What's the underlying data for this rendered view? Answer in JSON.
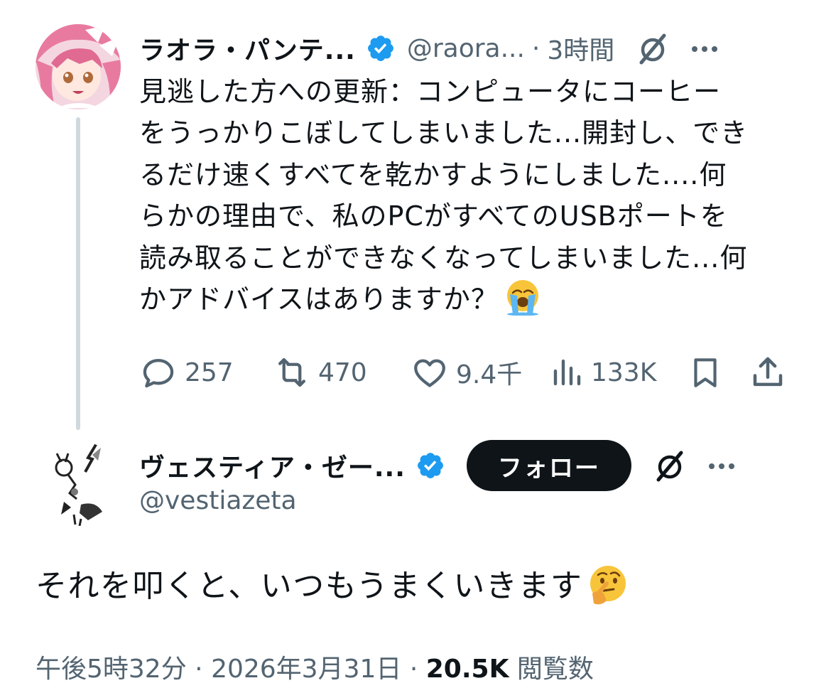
{
  "tweet1": {
    "display_name": "ラオラ・パンテ...",
    "handle": "@raora...",
    "separator": "·",
    "time": "3時間",
    "lines": [
      "見逃した方への更新：コンピュータにコーヒー",
      "をうっかりこぼしてしまいました...開封し、でき",
      "るだけ速くすべてを乾かすようにしました....何",
      "らかの理由で、私のPCがすべてのUSBポートを",
      "読み取ることができなくなってしまいました...何",
      "かアドバイスはありますか？"
    ],
    "emoji": "loudly-crying-face",
    "replies": "257",
    "reposts": "470",
    "likes": "9.4千",
    "views": "133K"
  },
  "tweet2": {
    "display_name": "ヴェスティア・ゼー...",
    "handle": "@vestiazeta",
    "follow_label": "フォロー",
    "body": "それを叩くと、いつもうまくいきます",
    "emoji": "thinking-face",
    "time": "午後5時32分",
    "separator1": " · ",
    "date": "2026年3月31日",
    "separator2": " · ",
    "views_count": "20.5K",
    "views_label": " 閲覧数"
  },
  "colors": {
    "verified": "#1d9bf0",
    "secondary_text": "#536471",
    "thread_line": "#cfd9de",
    "button_bg": "#0f1419"
  }
}
